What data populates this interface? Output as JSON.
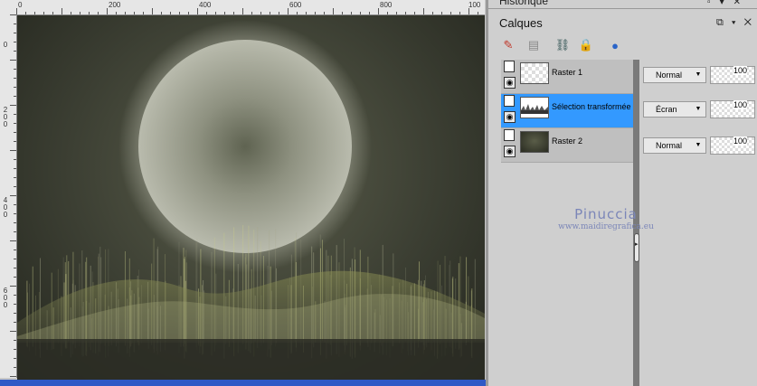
{
  "ruler": {
    "top_labels": [
      "0",
      "200",
      "400",
      "600",
      "800",
      "100"
    ],
    "left_labels": [
      "0",
      "200",
      "400",
      "600"
    ]
  },
  "historique": {
    "title": "Historique"
  },
  "layers_panel": {
    "title": "Calques",
    "window_controls": [
      "restore-icon",
      "menu-arrow-icon",
      "close-icon"
    ],
    "toolbar_icons": [
      "new-raster-layer-icon",
      "new-vector-layer-icon",
      "link-icon",
      "lock-icon",
      "mask-icon"
    ],
    "layers": [
      {
        "name": "Raster 1",
        "blend_mode": "Normal",
        "opacity": "100",
        "selected": false,
        "thumbnail": "transparent"
      },
      {
        "name": "Sélection transformée",
        "blend_mode": "Écran",
        "opacity": "100",
        "selected": true,
        "thumbnail": "selection"
      },
      {
        "name": "Raster 2",
        "blend_mode": "Normal",
        "opacity": "100",
        "selected": false,
        "thumbnail": "dark"
      }
    ]
  },
  "watermark": {
    "name": "Pinuccia",
    "url": "www.maidiregrafica.eu"
  },
  "colors": {
    "selection": "#3399ff",
    "canvas_dark": "#2b2d24",
    "wave_glow": "#9fa35e",
    "status_bar": "#2f59c6"
  }
}
